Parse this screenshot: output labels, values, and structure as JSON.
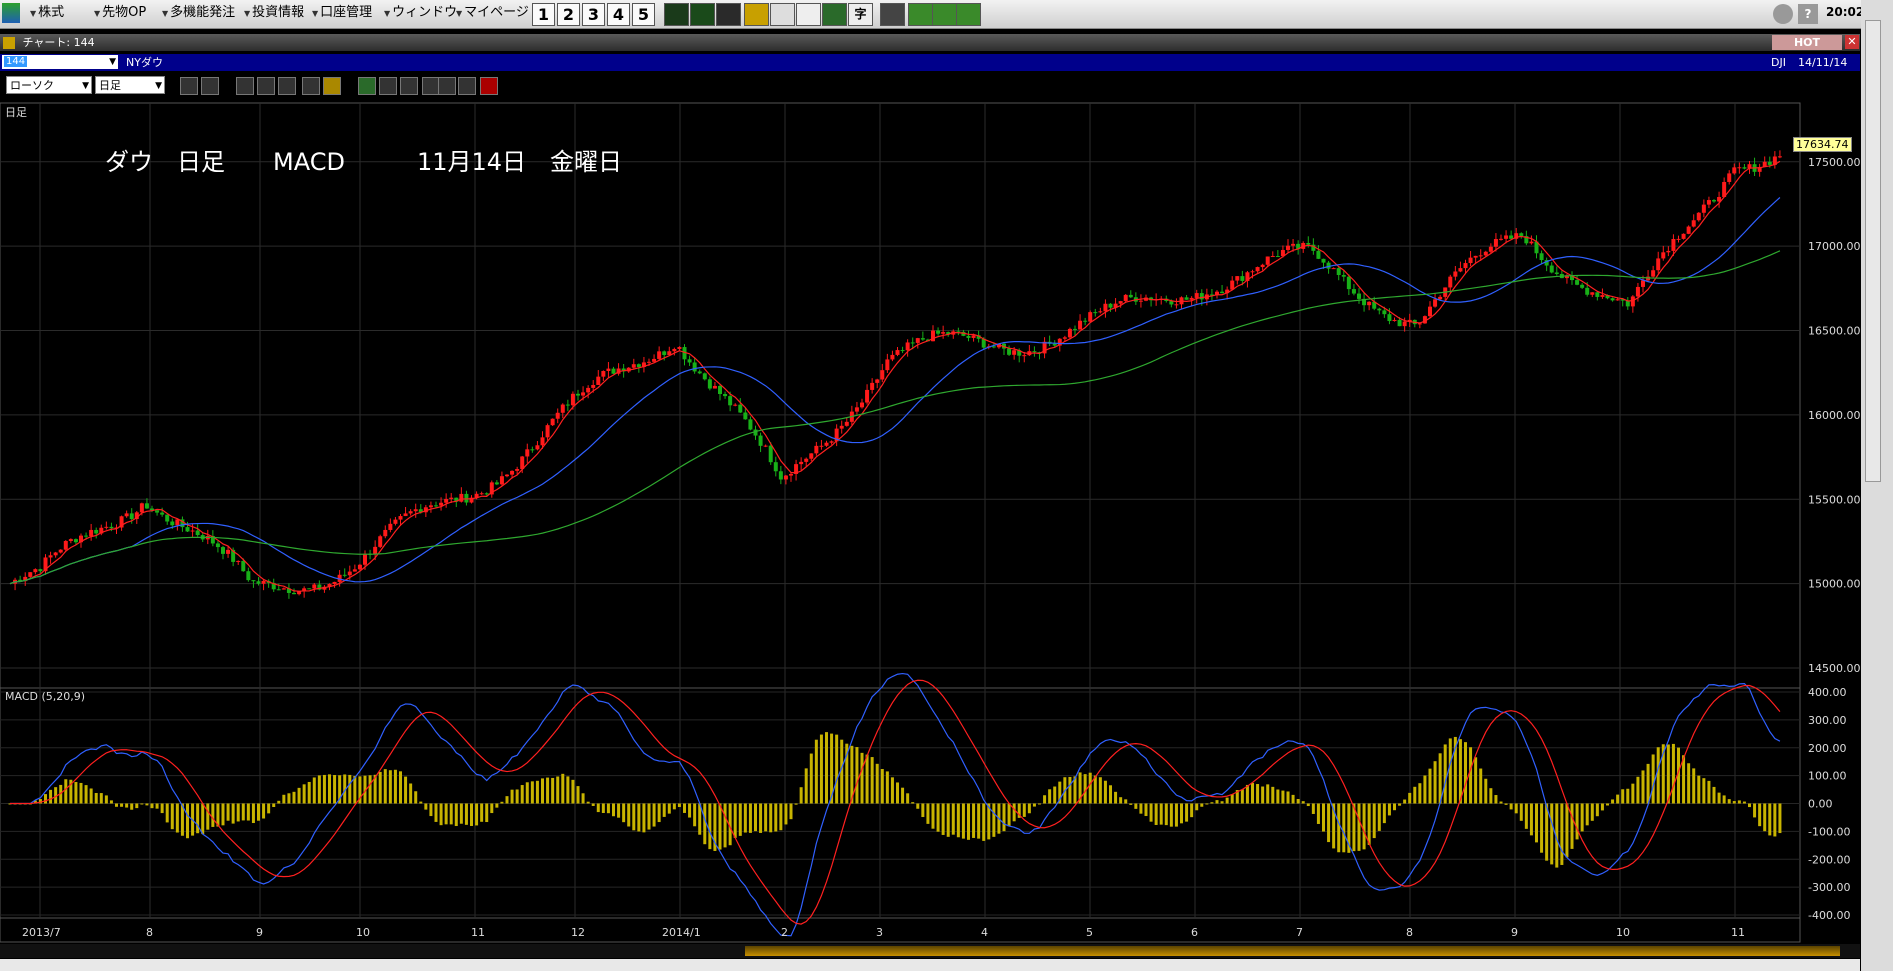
{
  "menubar": {
    "items": [
      "株式",
      "先物OP",
      "多機能発注",
      "投資情報",
      "口座管理",
      "ウィンドウ",
      "マイページ"
    ],
    "number_buttons": [
      "1",
      "2",
      "3",
      "4",
      "5"
    ],
    "clock": "20:02"
  },
  "window": {
    "title": "チャート: 144",
    "hot_label": "HOT",
    "symbol_code": "144",
    "symbol_name": "NYダウ",
    "ticker": "DJI",
    "date": "14/11/14"
  },
  "toolbar": {
    "chart_type": "ローソク",
    "period": "日足"
  },
  "chart": {
    "period_label": "日足",
    "annotation": "ダウ　日足　　MACD　　　11月14日　金曜日",
    "last_price": "17634.74",
    "price_ticks": [
      "17500.00",
      "17000.00",
      "16500.00",
      "16000.00",
      "15500.00",
      "15000.00",
      "14500.00"
    ],
    "macd_label": "MACD (5,20,9)",
    "macd_ticks": [
      "400.00",
      "300.00",
      "200.00",
      "100.00",
      "0.00",
      "-100.00",
      "-200.00",
      "-300.00",
      "-400.00"
    ],
    "x_labels": [
      "2013/7",
      "8",
      "9",
      "10",
      "11",
      "12",
      "2014/1",
      "2",
      "3",
      "4",
      "5",
      "6",
      "7",
      "8",
      "9",
      "10",
      "11"
    ]
  },
  "chart_data": {
    "type": "candlestick",
    "price_range": [
      14500,
      17700
    ],
    "macd_range": [
      -400,
      400
    ],
    "x_labels": [
      "2013/7",
      "8",
      "9",
      "10",
      "11",
      "12",
      "2014/1",
      "2",
      "3",
      "4",
      "5",
      "6",
      "7",
      "8",
      "9",
      "10",
      "11"
    ],
    "close_by_month": [
      15000,
      15500,
      14900,
      15150,
      15600,
      16050,
      16500,
      15500,
      16300,
      16450,
      16600,
      16850,
      16900,
      16500,
      17050,
      16600,
      17600
    ],
    "colors": {
      "up": "#ff1a1a",
      "down": "#18b018",
      "ma_short": "#ff2020",
      "ma_mid": "#3060ff",
      "ma_long": "#2fa82f",
      "hist": "#c8b400"
    }
  }
}
